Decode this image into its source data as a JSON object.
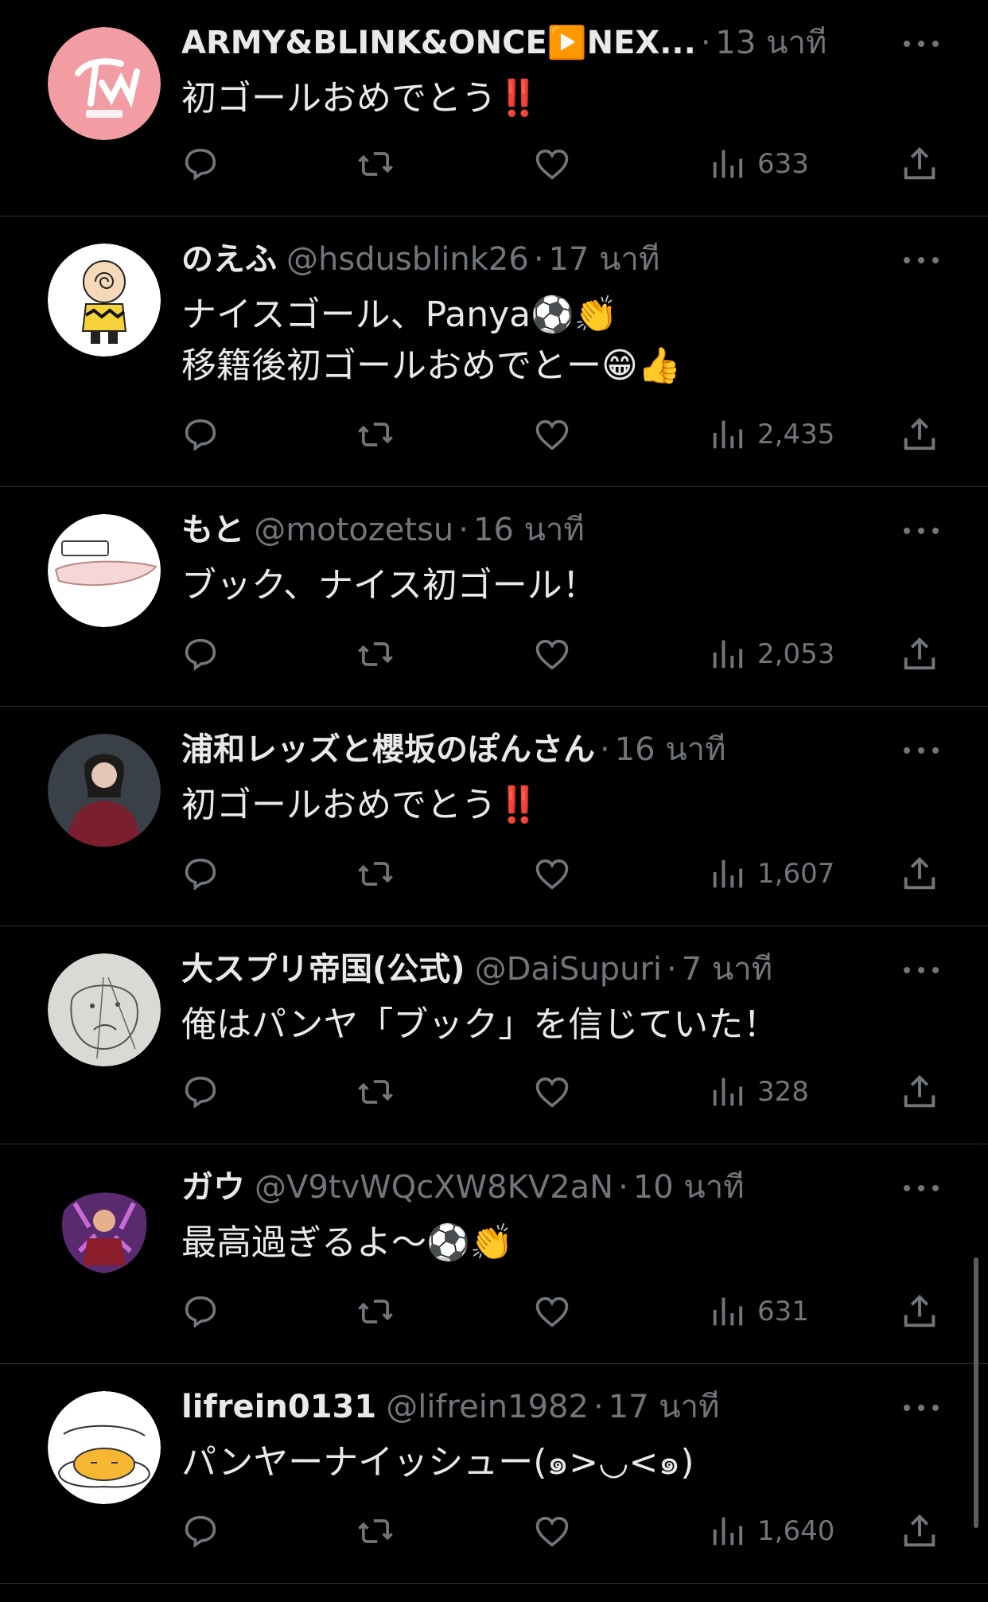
{
  "colors": {
    "background": "#000000",
    "text": "#e7e9ea",
    "muted": "#71767b",
    "divider": "#2f3336"
  },
  "tweets": [
    {
      "display_name": "ARMY&BLINK&ONCE▶️NEX...",
      "handle": "",
      "time": "13 นาที",
      "text": "初ゴールおめでとう‼️",
      "views": "633",
      "avatar": "twice-logo-avatar"
    },
    {
      "display_name": "のえふ",
      "handle": "@hsdusblink26",
      "time": "17 นาที",
      "text": "ナイスゴール、Panya⚽👏\n移籍後初ゴールおめでとー😁👍",
      "views": "2,435",
      "avatar": "charlie-brown-avatar"
    },
    {
      "display_name": "もと",
      "handle": "@motozetsu",
      "time": "16 นาที",
      "text": "ブック、ナイス初ゴール！",
      "views": "2,053",
      "avatar": "shake-sticker-avatar"
    },
    {
      "display_name": "浦和レッズと櫻坂のぽんさん",
      "handle": "",
      "time": "16 นาที",
      "text": "初ゴールおめでとう‼️",
      "views": "1,607",
      "avatar": "photo-person-avatar"
    },
    {
      "display_name": "大スプリ帝国(公式)",
      "handle": "@DaiSupuri",
      "time": "7 นาที",
      "text": "俺はパンヤ「ブック」を信じていた！",
      "views": "328",
      "avatar": "sketch-face-avatar"
    },
    {
      "display_name": "ガウ",
      "handle": "@V9tvWQcXW8KV2aN",
      "time": "10 นาที",
      "text": "最高過ぎるよ〜⚽👏",
      "views": "631",
      "avatar": "anime-character-avatar"
    },
    {
      "display_name": "lifrein0131",
      "handle": "@lifrein1982",
      "time": "17 นาที",
      "text": "パンヤーナイッシュー(๑>◡<๑)",
      "views": "1,640",
      "avatar": "gudetama-avatar"
    }
  ],
  "icons": [
    "reply-icon",
    "retweet-icon",
    "like-icon",
    "views-icon",
    "share-icon",
    "more-icon"
  ]
}
